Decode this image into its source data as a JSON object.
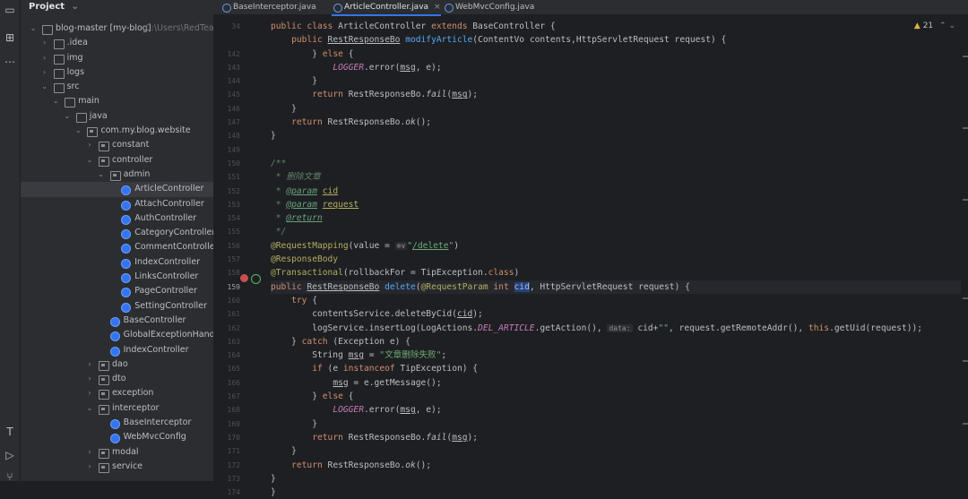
{
  "project_panel": {
    "title": "Project",
    "tree": [
      {
        "label": "blog-master [my-blog]",
        "hint": "C:\\Users\\RedTeam",
        "indent": 0,
        "arrow": "open",
        "icon": "folder"
      },
      {
        "label": ".idea",
        "indent": 1,
        "arrow": "closed",
        "icon": "folder"
      },
      {
        "label": "img",
        "indent": 1,
        "arrow": "closed",
        "icon": "folder"
      },
      {
        "label": "logs",
        "indent": 1,
        "arrow": "closed",
        "icon": "folder"
      },
      {
        "label": "src",
        "indent": 1,
        "arrow": "open",
        "icon": "folder"
      },
      {
        "label": "main",
        "indent": 2,
        "arrow": "open",
        "icon": "folder"
      },
      {
        "label": "java",
        "indent": 3,
        "arrow": "open",
        "icon": "folder"
      },
      {
        "label": "com.my.blog.website",
        "indent": 4,
        "arrow": "open",
        "icon": "pkg"
      },
      {
        "label": "constant",
        "indent": 5,
        "arrow": "closed",
        "icon": "pkg"
      },
      {
        "label": "controller",
        "indent": 5,
        "arrow": "open",
        "icon": "pkg"
      },
      {
        "label": "admin",
        "indent": 6,
        "arrow": "open",
        "icon": "pkg"
      },
      {
        "label": "ArticleController",
        "indent": 7,
        "arrow": "none",
        "icon": "cls",
        "selected": true
      },
      {
        "label": "AttachController",
        "indent": 7,
        "arrow": "none",
        "icon": "cls"
      },
      {
        "label": "AuthController",
        "indent": 7,
        "arrow": "none",
        "icon": "cls"
      },
      {
        "label": "CategoryController",
        "indent": 7,
        "arrow": "none",
        "icon": "cls"
      },
      {
        "label": "CommentController",
        "indent": 7,
        "arrow": "none",
        "icon": "cls"
      },
      {
        "label": "IndexController",
        "indent": 7,
        "arrow": "none",
        "icon": "cls"
      },
      {
        "label": "LinksController",
        "indent": 7,
        "arrow": "none",
        "icon": "cls"
      },
      {
        "label": "PageController",
        "indent": 7,
        "arrow": "none",
        "icon": "cls"
      },
      {
        "label": "SettingController",
        "indent": 7,
        "arrow": "none",
        "icon": "cls"
      },
      {
        "label": "BaseController",
        "indent": 6,
        "arrow": "none",
        "icon": "cls"
      },
      {
        "label": "GlobalExceptionHandler",
        "indent": 6,
        "arrow": "none",
        "icon": "cls"
      },
      {
        "label": "IndexController",
        "indent": 6,
        "arrow": "none",
        "icon": "cls"
      },
      {
        "label": "dao",
        "indent": 5,
        "arrow": "closed",
        "icon": "pkg"
      },
      {
        "label": "dto",
        "indent": 5,
        "arrow": "closed",
        "icon": "pkg"
      },
      {
        "label": "exception",
        "indent": 5,
        "arrow": "closed",
        "icon": "pkg"
      },
      {
        "label": "interceptor",
        "indent": 5,
        "arrow": "open",
        "icon": "pkg"
      },
      {
        "label": "BaseInterceptor",
        "indent": 6,
        "arrow": "none",
        "icon": "cls"
      },
      {
        "label": "WebMvcConfig",
        "indent": 6,
        "arrow": "none",
        "icon": "cls"
      },
      {
        "label": "modal",
        "indent": 5,
        "arrow": "closed",
        "icon": "pkg"
      },
      {
        "label": "service",
        "indent": 5,
        "arrow": "closed",
        "icon": "pkg"
      }
    ]
  },
  "tabs": [
    {
      "label": "BaseInterceptor.java",
      "active": false
    },
    {
      "label": "ArticleController.java",
      "active": true
    },
    {
      "label": "WebMvcConfig.java",
      "active": false
    }
  ],
  "inspections": {
    "warnings": "21"
  },
  "editor": {
    "lines": [
      {
        "n": "34",
        "html": "<span class=\"kw\">public class</span> ArticleController <span class=\"kw\">extends</span> BaseController {"
      },
      {
        "n": "",
        "html": "    <span class=\"kw\">public</span> <span class=\"ul\">RestResponseBo</span> <span class=\"fn\">modifyArticle</span>(ContentVo contents,HttpServletRequest request) {"
      },
      {
        "n": "142",
        "html": "        } <span class=\"kw\">else</span> {"
      },
      {
        "n": "143",
        "html": "            <span class=\"const\">LOGGER</span>.error(<span class=\"ul\">msg</span>, e);"
      },
      {
        "n": "144",
        "html": "        }"
      },
      {
        "n": "145",
        "html": "        <span class=\"kw\">return</span> RestResponseBo.<span class=\"it\">fail</span>(<span class=\"ul\">msg</span>);"
      },
      {
        "n": "146",
        "html": "    }"
      },
      {
        "n": "147",
        "html": "    <span class=\"kw\">return</span> RestResponseBo.<span class=\"it\">ok</span>();"
      },
      {
        "n": "148",
        "html": "}"
      },
      {
        "n": "149",
        "html": ""
      },
      {
        "n": "150",
        "html": "<span class=\"cmt\">/**</span>"
      },
      {
        "n": "151",
        "html": "<span class=\"cmt\"> * 删除文章</span>"
      },
      {
        "n": "152",
        "html": "<span class=\"cmt\"> * </span><span class=\"tag\">@param</span><span class=\"cmt\"> </span><span class=\"ann ul\">cid</span>"
      },
      {
        "n": "153",
        "html": "<span class=\"cmt\"> * </span><span class=\"tag\">@param</span><span class=\"cmt\"> </span><span class=\"ann ul\">request</span>"
      },
      {
        "n": "154",
        "html": "<span class=\"cmt\"> * </span><span class=\"tag\">@return</span>"
      },
      {
        "n": "155",
        "html": "<span class=\"cmt\"> */</span>"
      },
      {
        "n": "156",
        "html": "<span class=\"ann\">@RequestMapping</span>(value = <span class=\"hint\">⊕∨</span><span class=\"str\">\"<span class=\"ul\">/delete</span>\"</span>)"
      },
      {
        "n": "157",
        "html": "<span class=\"ann\">@ResponseBody</span>"
      },
      {
        "n": "158",
        "html": "<span class=\"ann\">@Transactional</span>(rollbackFor = TipException.<span class=\"kw\">class</span>)"
      },
      {
        "n": "159",
        "cur": true,
        "html": "<span class=\"kw\">public</span> <span class=\"ul\">RestResponseBo</span> <span class=\"fn\">delete</span>(<span class=\"ann\">@RequestParam</span> <span class=\"kw\">int</span> <span class=\"hl\">cid</span>, HttpServletRequest request) {"
      },
      {
        "n": "160",
        "html": "    <span class=\"kw\">try</span> {"
      },
      {
        "n": "161",
        "html": "        contentsService.deleteByCid(<span class=\"ul\">cid</span>);"
      },
      {
        "n": "162",
        "html": "        logService.insertLog(LogActions.<span class=\"const\">DEL_ARTICLE</span>.getAction(), <span class=\"hint\">data:</span> cid+<span class=\"str\">\"\"</span>, request.getRemoteAddr(), <span class=\"kw\">this</span>.getUid(request));"
      },
      {
        "n": "163",
        "html": "    } <span class=\"kw\">catch</span> (Exception e) {"
      },
      {
        "n": "164",
        "html": "        String <span class=\"ul\">msg</span> = <span class=\"str\">\"文章删除失败\"</span>;"
      },
      {
        "n": "165",
        "html": "        <span class=\"kw\">if</span> (e <span class=\"kw\">instanceof</span> TipException) {"
      },
      {
        "n": "166",
        "html": "            <span class=\"ul\">msg</span> = e.getMessage();"
      },
      {
        "n": "167",
        "html": "        } <span class=\"kw\">else</span> {"
      },
      {
        "n": "168",
        "html": "            <span class=\"const\">LOGGER</span>.error(<span class=\"ul\">msg</span>, e);"
      },
      {
        "n": "169",
        "html": "        }"
      },
      {
        "n": "170",
        "html": "        <span class=\"kw\">return</span> RestResponseBo.<span class=\"it\">fail</span>(<span class=\"ul\">msg</span>);"
      },
      {
        "n": "171",
        "html": "    }"
      },
      {
        "n": "172",
        "html": "    <span class=\"kw\">return</span> RestResponseBo.<span class=\"it\">ok</span>();"
      },
      {
        "n": "173",
        "html": "}"
      },
      {
        "n": "174",
        "html": "}"
      }
    ]
  },
  "colors": {
    "accent": "#3574f0",
    "background": "#1e1f22",
    "panel": "#2b2d30"
  }
}
